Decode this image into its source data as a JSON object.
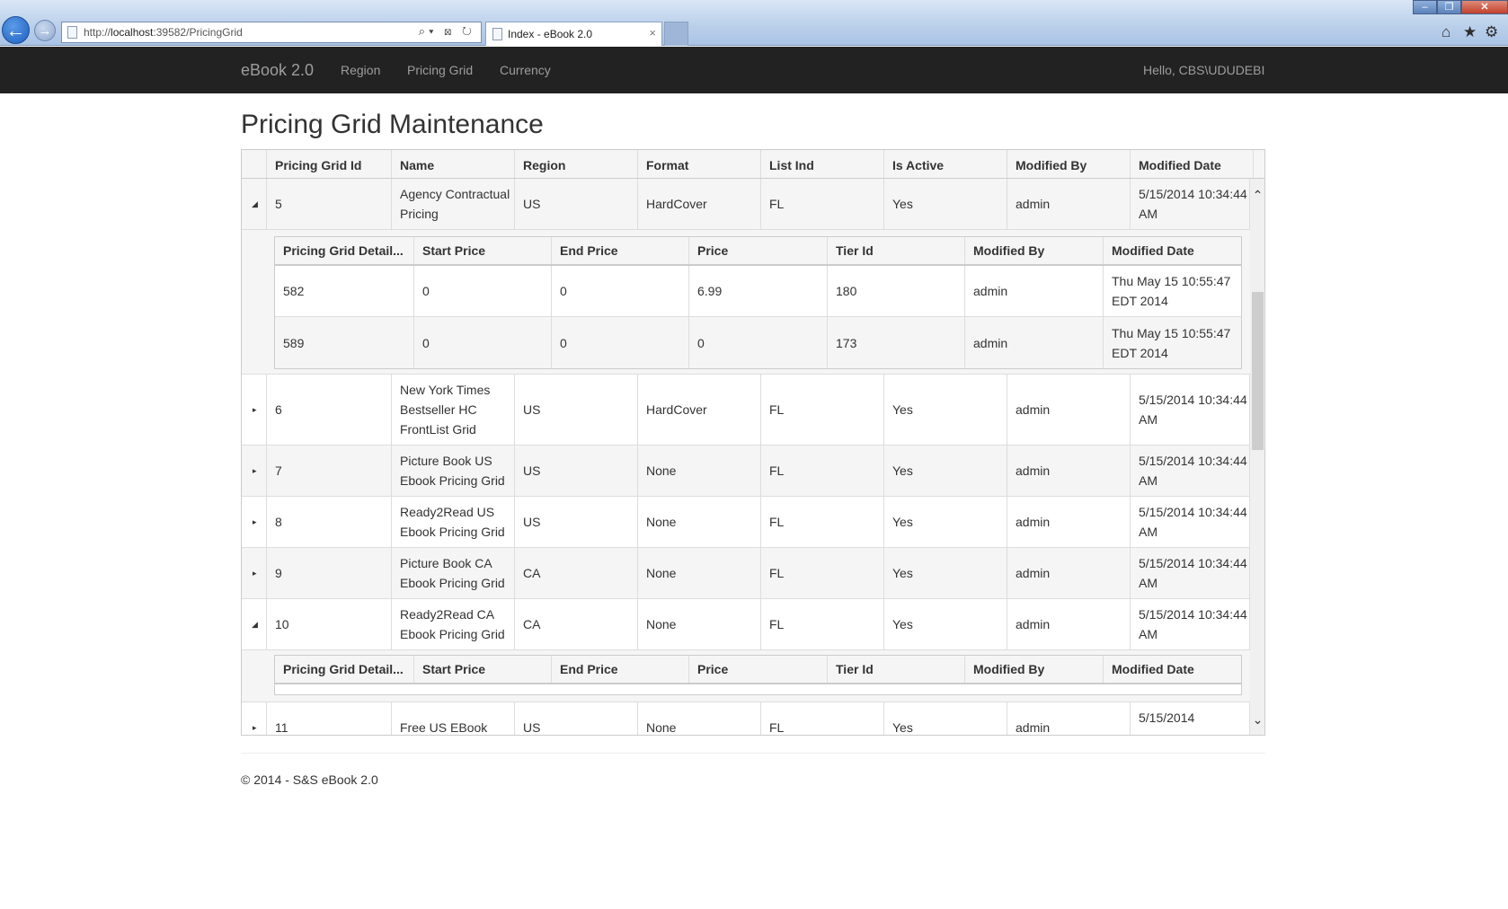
{
  "browser": {
    "url_prefix": "http://",
    "url_host": "localhost",
    "url_rest": ":39582/PricingGrid",
    "tab_title": "Index - eBook 2.0",
    "tab_close": "×",
    "back_glyph": "←",
    "forward_glyph": "→",
    "addr_tools": "⌕▾ ⊠ ↻",
    "win_min": "–",
    "win_max": "❐",
    "win_close": "✕",
    "home_glyph": "⌂",
    "star_glyph": "★",
    "gear_glyph": "⚙"
  },
  "navbar": {
    "brand": "eBook 2.0",
    "links": [
      "Region",
      "Pricing Grid",
      "Currency"
    ],
    "greeting": "Hello, CBS\\UDUDEBI"
  },
  "page": {
    "title": "Pricing Grid Maintenance"
  },
  "grid": {
    "columns": [
      "Pricing Grid Id",
      "Name",
      "Region",
      "Format",
      "List Ind",
      "Is Active",
      "Modified By",
      "Modified Date"
    ],
    "rows": [
      {
        "id": "5",
        "name": "Agency Contractual Pricing",
        "region": "US",
        "format": "HardCover",
        "list_ind": "FL",
        "active": "Yes",
        "modified_by": "admin",
        "modified_date": "5/15/2014 10:34:44 AM",
        "expanded": true
      },
      {
        "id": "6",
        "name": "New York Times Bestseller HC FrontList Grid",
        "region": "US",
        "format": "HardCover",
        "list_ind": "FL",
        "active": "Yes",
        "modified_by": "admin",
        "modified_date": "5/15/2014 10:34:44 AM",
        "expanded": false
      },
      {
        "id": "7",
        "name": "Picture Book US Ebook Pricing Grid",
        "region": "US",
        "format": "None",
        "list_ind": "FL",
        "active": "Yes",
        "modified_by": "admin",
        "modified_date": "5/15/2014 10:34:44 AM",
        "expanded": false
      },
      {
        "id": "8",
        "name": "Ready2Read US Ebook Pricing Grid",
        "region": "US",
        "format": "None",
        "list_ind": "FL",
        "active": "Yes",
        "modified_by": "admin",
        "modified_date": "5/15/2014 10:34:44 AM",
        "expanded": false
      },
      {
        "id": "9",
        "name": "Picture Book CA Ebook Pricing Grid",
        "region": "CA",
        "format": "None",
        "list_ind": "FL",
        "active": "Yes",
        "modified_by": "admin",
        "modified_date": "5/15/2014 10:34:44 AM",
        "expanded": false
      },
      {
        "id": "10",
        "name": "Ready2Read CA Ebook Pricing Grid",
        "region": "CA",
        "format": "None",
        "list_ind": "FL",
        "active": "Yes",
        "modified_by": "admin",
        "modified_date": "5/15/2014 10:34:44 AM",
        "expanded": true
      },
      {
        "id": "11",
        "name": "Free US EBook",
        "region": "US",
        "format": "None",
        "list_ind": "FL",
        "active": "Yes",
        "modified_by": "admin",
        "modified_date": "5/15/2014",
        "expanded": false
      }
    ],
    "detail_columns": [
      "Pricing Grid Detail...",
      "Start Price",
      "End Price",
      "Price",
      "Tier Id",
      "Modified By",
      "Modified Date"
    ],
    "detail_5": [
      {
        "detail_id": "582",
        "start": "0",
        "end": "0",
        "price": "6.99",
        "tier": "180",
        "modified_by": "admin",
        "modified_date": "Thu May 15 10:55:47 EDT 2014"
      },
      {
        "detail_id": "589",
        "start": "0",
        "end": "0",
        "price": "0",
        "tier": "173",
        "modified_by": "admin",
        "modified_date": "Thu May 15 10:55:47 EDT 2014"
      }
    ],
    "expanded_glyph": "◢",
    "collapsed_glyph": "▸",
    "scroll_up": "⌃",
    "scroll_down": "⌄"
  },
  "footer": {
    "text": "© 2014 - S&S eBook 2.0"
  }
}
